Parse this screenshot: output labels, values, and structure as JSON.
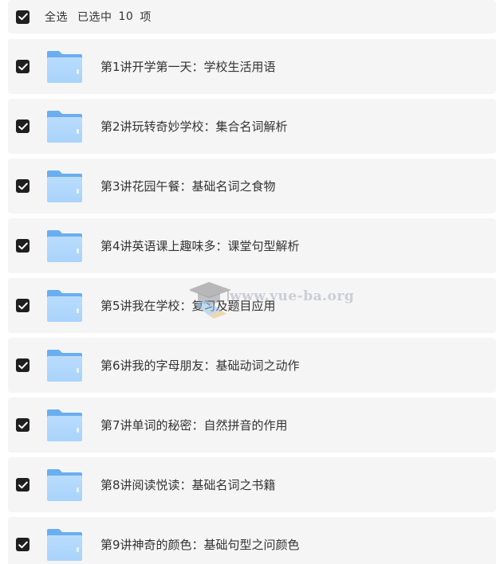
{
  "header": {
    "select_all_label": "全选",
    "selected_prefix": "已选中",
    "selected_count": "10",
    "selected_suffix": "项",
    "all_checked": true
  },
  "items": [
    {
      "label": "第1讲开学第一天：学校生活用语",
      "checked": true,
      "icon": "folder-icon"
    },
    {
      "label": "第2讲玩转奇妙学校：集合名词解析",
      "checked": true,
      "icon": "folder-icon"
    },
    {
      "label": "第3讲花园午餐：基础名词之食物",
      "checked": true,
      "icon": "folder-icon"
    },
    {
      "label": "第4讲英语课上趣味多：课堂句型解析",
      "checked": true,
      "icon": "folder-icon"
    },
    {
      "label": "第5讲我在学校：复习及题目应用",
      "checked": true,
      "icon": "folder-icon"
    },
    {
      "label": "第6讲我的字母朋友：基础动词之动作",
      "checked": true,
      "icon": "folder-icon"
    },
    {
      "label": "第7讲单词的秘密：自然拼音的作用",
      "checked": true,
      "icon": "folder-icon"
    },
    {
      "label": "第8讲阅读悦读：基础名词之书籍",
      "checked": true,
      "icon": "folder-icon"
    },
    {
      "label": "第9讲神奇的颜色：基础句型之问颜色",
      "checked": true,
      "icon": "folder-icon"
    }
  ],
  "watermark": {
    "text": "www.yue-ba.org",
    "icon": "graduation-cap-icon"
  },
  "colors": {
    "checkbox": "#1f1f1f",
    "row_background": "#f5f5f5",
    "folder_light": "#a9d3fb",
    "folder_dark": "#6aaef0",
    "text": "#333333"
  }
}
